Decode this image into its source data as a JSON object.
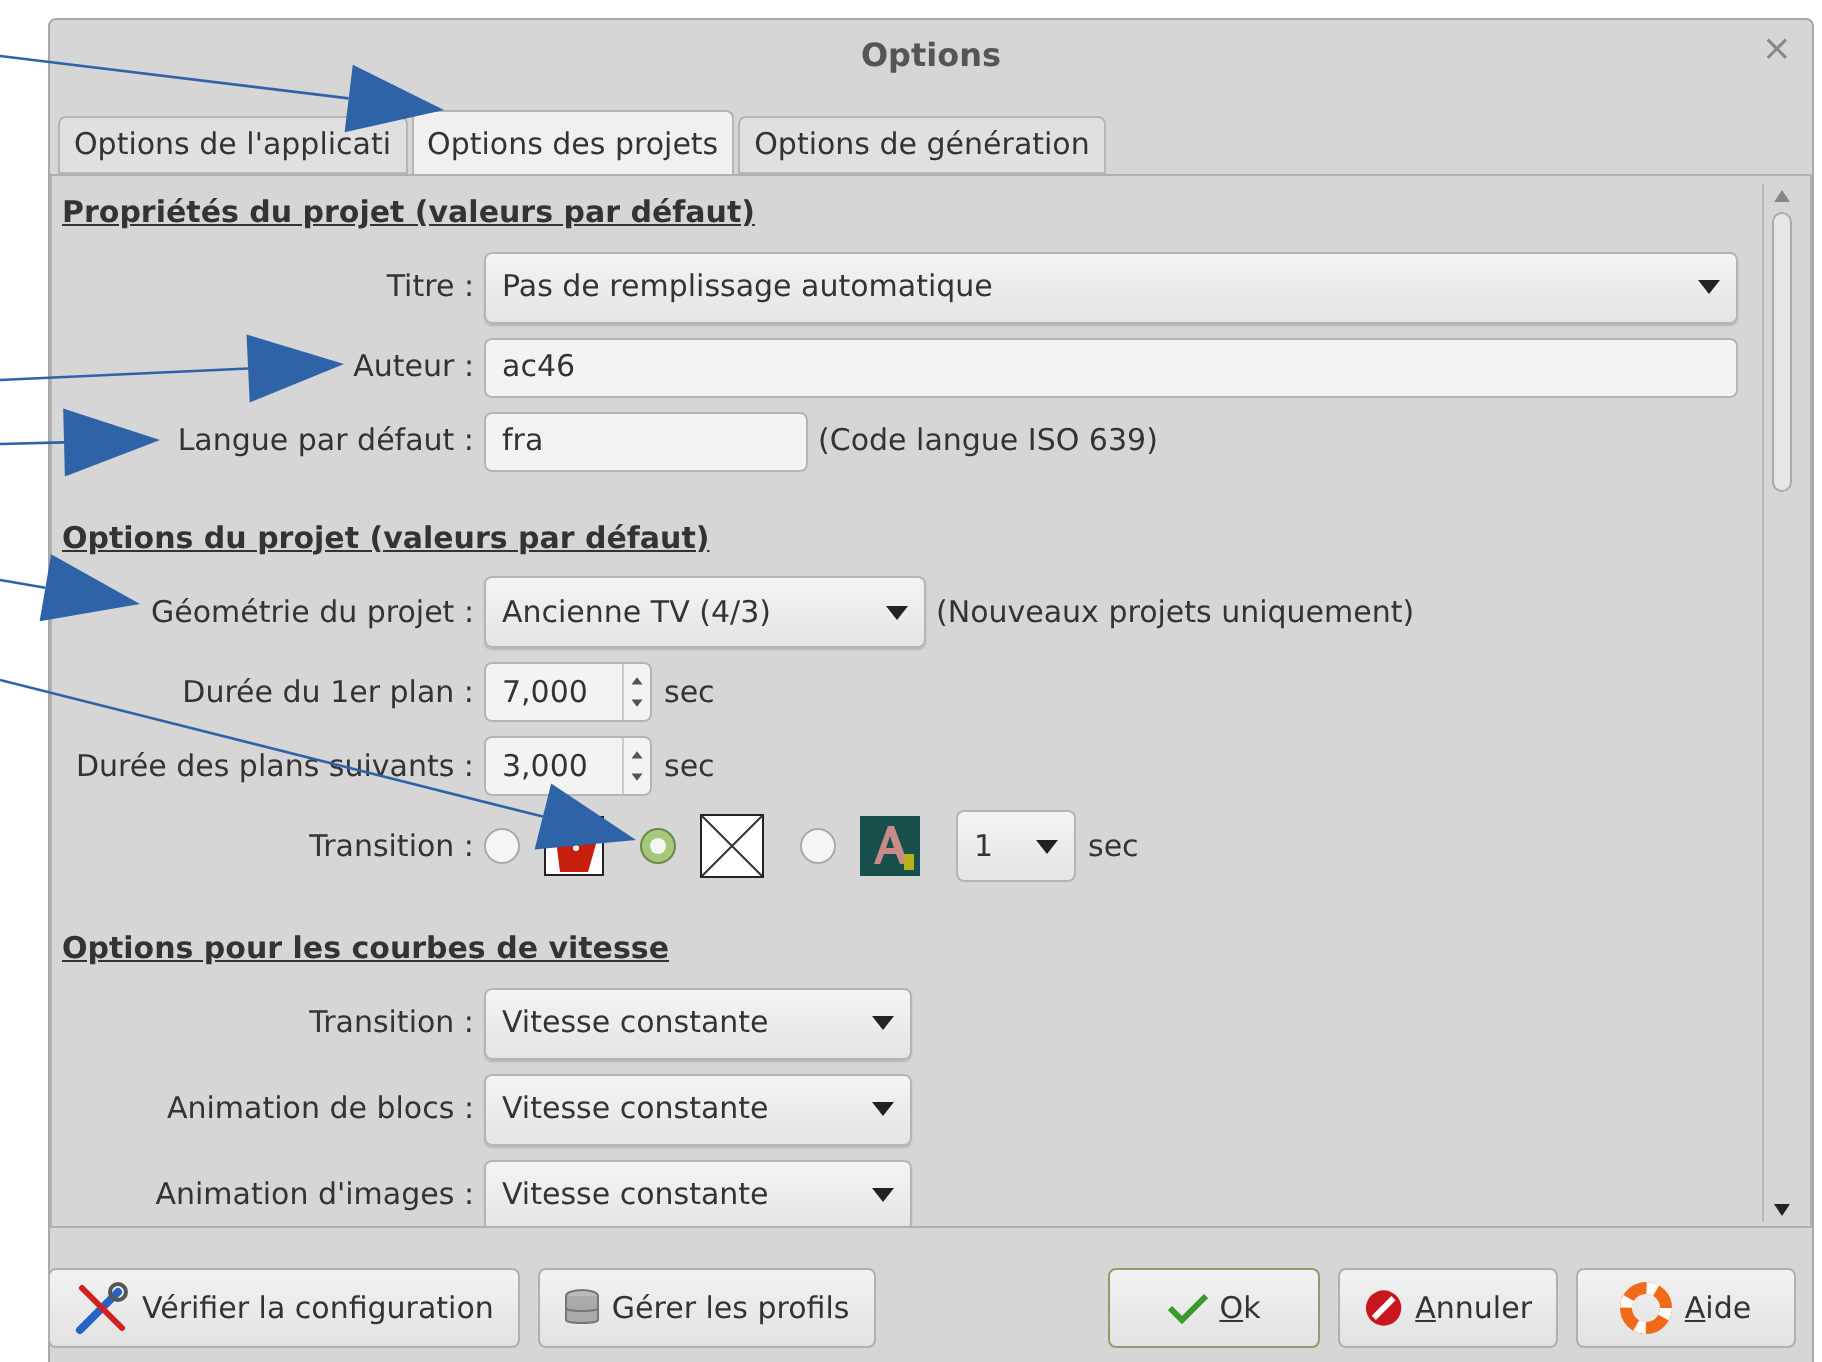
{
  "window": {
    "title": "Options",
    "close": "×"
  },
  "tabs": [
    {
      "label": "Options de l'applicati",
      "selected": false
    },
    {
      "label": "Options des projets",
      "selected": true
    },
    {
      "label": "Options de génération",
      "selected": false
    }
  ],
  "sections": [
    {
      "title": "Propriétés du projet (valeurs par défaut)",
      "rows": [
        {
          "kind": "combo-full",
          "label": "Titre :",
          "value": "Pas de remplissage automatique"
        },
        {
          "kind": "text-full",
          "label": "Auteur :",
          "value": "ac46"
        },
        {
          "kind": "text",
          "label": "Langue par défaut :",
          "value": "fra",
          "note": "(Code langue ISO 639)"
        }
      ]
    },
    {
      "title": "Options du projet (valeurs par défaut)",
      "rows": [
        {
          "kind": "combo",
          "label": "Géométrie du projet :",
          "value": "Ancienne TV (4/3)",
          "note": "(Nouveaux projets uniquement)"
        },
        {
          "kind": "spin",
          "label": "Durée du 1er plan :",
          "value": "7,000",
          "unit": "sec"
        },
        {
          "kind": "spin",
          "label": "Durée des plans suivants :",
          "value": "3,000",
          "unit": "sec"
        },
        {
          "kind": "transition",
          "label": "Transition :",
          "options": [
            {
              "selected": false
            },
            {
              "selected": true
            },
            {
              "selected": false
            }
          ],
          "duration": "1",
          "unit": "sec"
        }
      ]
    },
    {
      "title": "Options pour les courbes de vitesse",
      "rows": [
        {
          "kind": "combo-short",
          "label": "Transition :",
          "value": "Vitesse constante"
        },
        {
          "kind": "combo-short",
          "label": "Animation de blocs :",
          "value": "Vitesse constante"
        },
        {
          "kind": "combo-short",
          "label": "Animation d'images :",
          "value": "Vitesse constante"
        }
      ]
    }
  ],
  "buttons": [
    {
      "label": "Vérifier la configuration",
      "mnemonic": false,
      "default": false
    },
    {
      "label": "Gérer les profils",
      "mnemonic": false,
      "default": false
    },
    {
      "label": "Ok",
      "mnemonic": true,
      "default": true
    },
    {
      "label": "Annuler",
      "mnemonic": true,
      "default": false
    },
    {
      "label": "Aide",
      "mnemonic": true,
      "default": false
    }
  ]
}
